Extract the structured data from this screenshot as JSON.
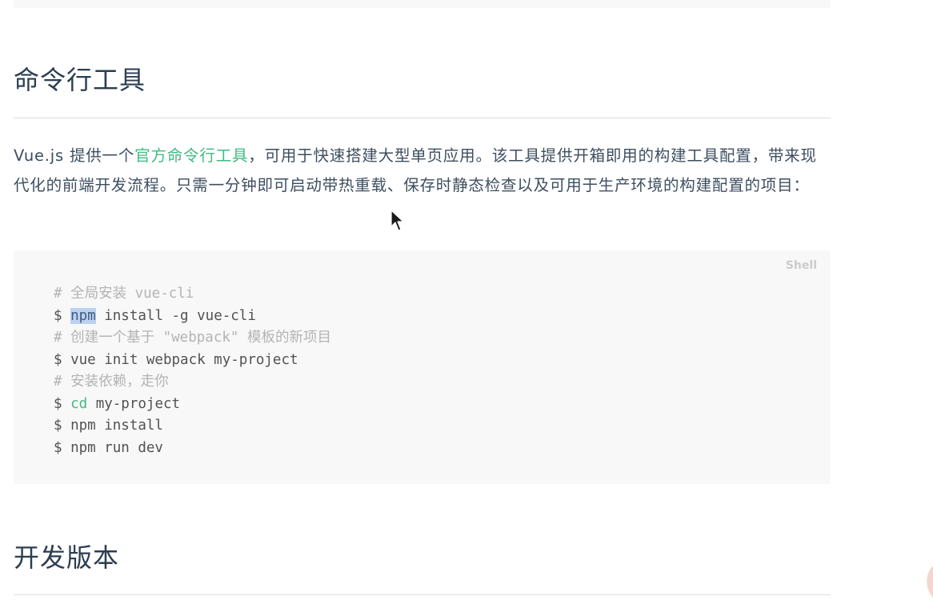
{
  "section1": {
    "title": "命令行工具",
    "intro": {
      "part1": "Vue.js 提供一个",
      "link": "官方命令行工具",
      "part2": "，可用于快速搭建大型单页应用。该工具提供开箱即用的构建工具配置，带来现代化的前端开发流程。只需一分钟即可启动带热重载、保存时静态检查以及可用于生产环境的构建配置的项目："
    },
    "code": {
      "language": "Shell",
      "line1_comment": "# 全局安装 vue-cli",
      "line2_prompt": "$ ",
      "line2_cmd": "npm",
      "line2_rest": " install -g vue-cli",
      "line3_comment": "# 创建一个基于 \"webpack\" 模板的新项目",
      "line4": "$ vue init webpack my-project",
      "line5_comment": "# 安装依赖，走你",
      "line6_prompt": "$ ",
      "line6_cmd": "cd",
      "line6_rest": " my-project",
      "line7": "$ npm install",
      "line8": "$ npm run dev"
    }
  },
  "section2": {
    "title": "开发版本"
  },
  "colors": {
    "link": "#42b983",
    "heading": "#2c3e50",
    "code_bg": "#f8f8f8",
    "comment": "#b3b3b3"
  },
  "icons": {
    "cursor": "mouse-pointer-icon"
  }
}
